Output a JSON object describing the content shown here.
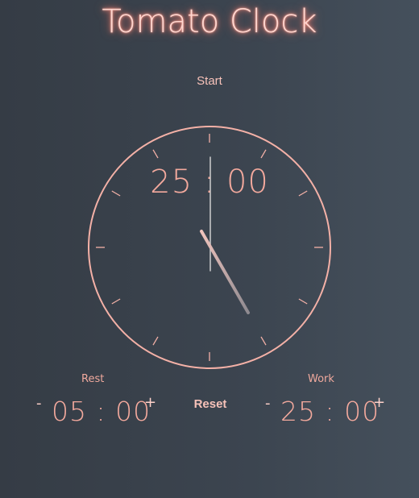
{
  "app": {
    "title": "Tomato Clock"
  },
  "controls": {
    "start_label": "Start",
    "reset_label": "Reset"
  },
  "clock": {
    "display": "25 : 00"
  },
  "rest": {
    "label": "Rest",
    "value": "05 : 00",
    "minus": "-",
    "plus": "+"
  },
  "work": {
    "label": "Work",
    "value": "25 : 00",
    "minus": "-",
    "plus": "+"
  },
  "colors": {
    "accent": "#f4b1a7",
    "background_left": "#353c45",
    "background_right": "#45505c"
  }
}
